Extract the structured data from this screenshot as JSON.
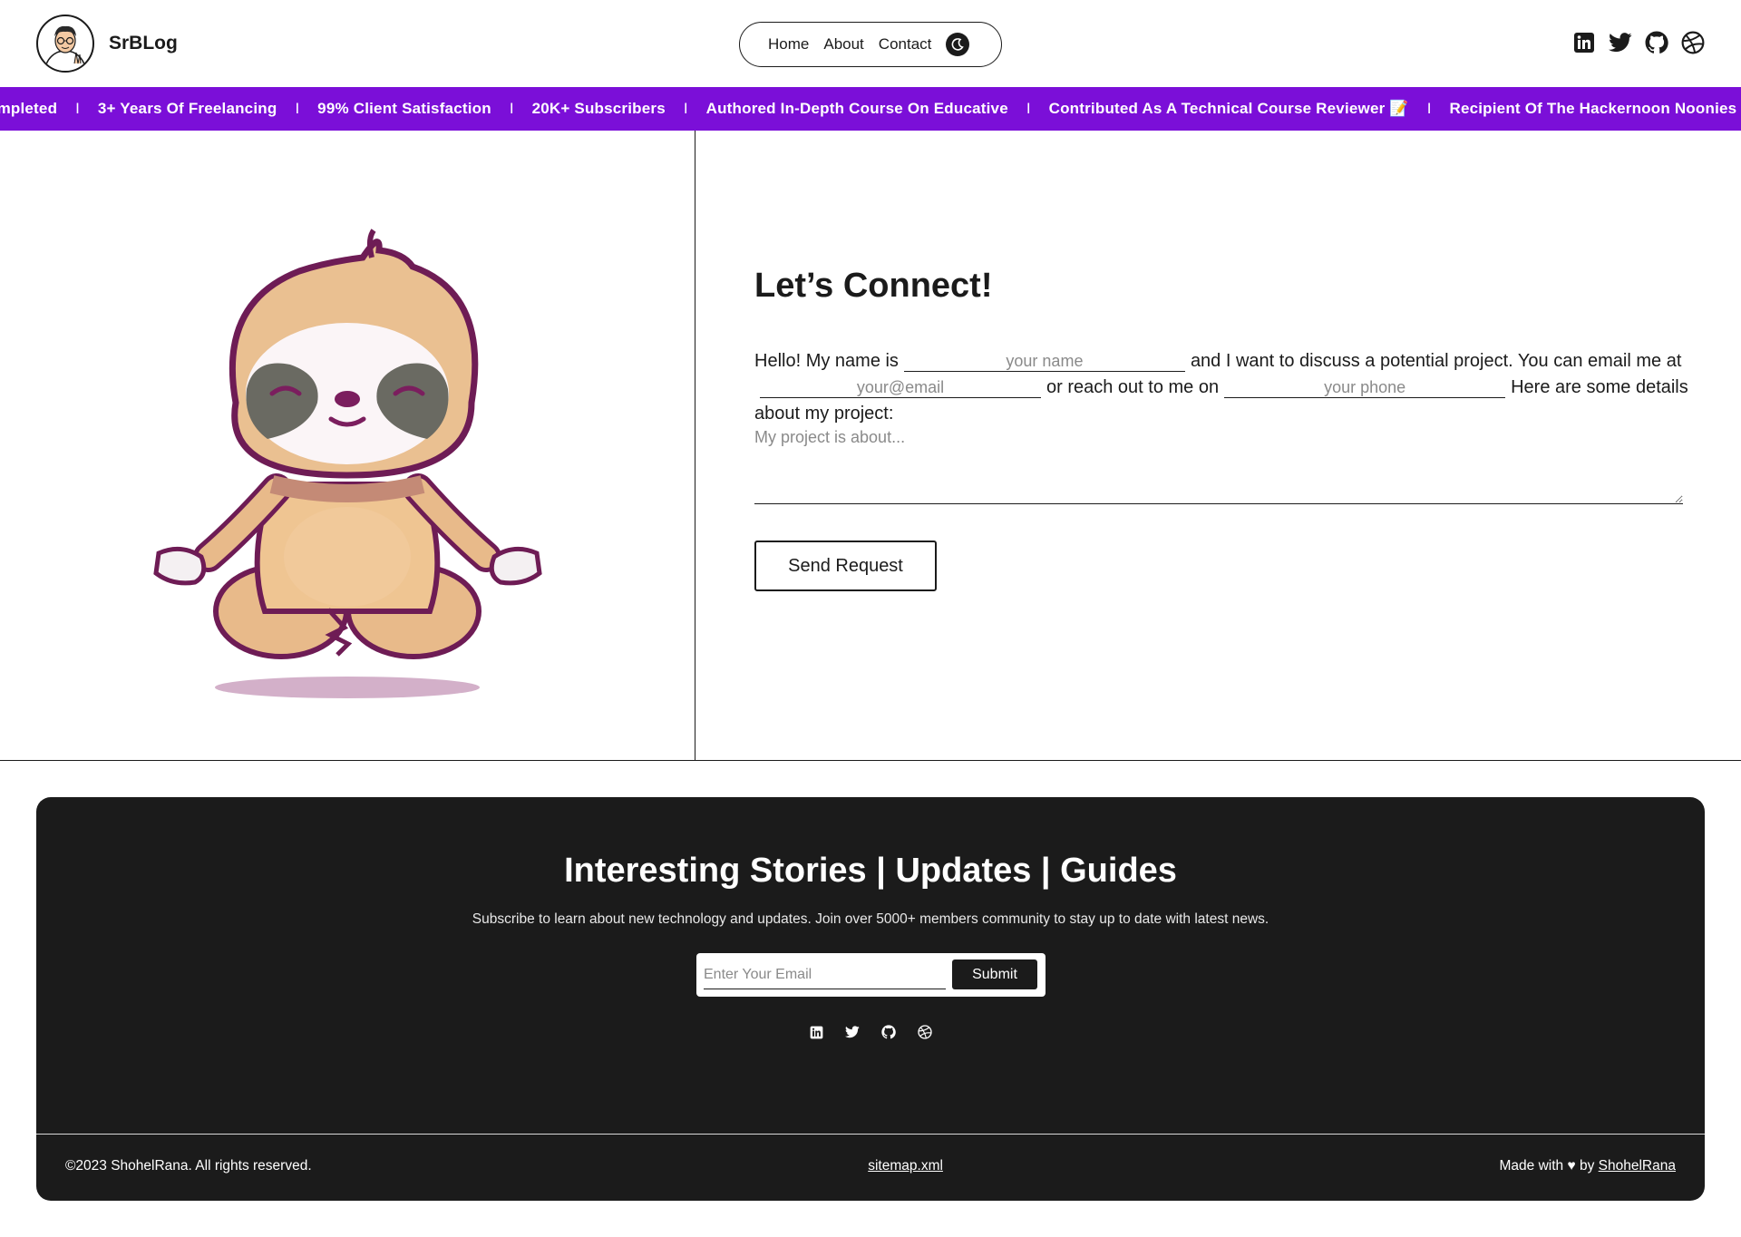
{
  "header": {
    "brand": "SrBLog",
    "nav": [
      {
        "label": "Home"
      },
      {
        "label": "About"
      },
      {
        "label": "Contact"
      }
    ],
    "theme_icon": "moon-icon",
    "socials": [
      "linkedin-icon",
      "twitter-icon",
      "github-icon",
      "dribbble-icon"
    ]
  },
  "marquee": {
    "items": [
      "ompleted",
      "3+ Years Of Freelancing",
      "99% Client Satisfaction",
      "20K+ Subscribers",
      "Authored In-Depth Course On Educative",
      "Contributed As A Technical Course Reviewer 📝",
      "Recipient Of The Hackernoon Noonies"
    ],
    "separator": "I",
    "background": "#7b0fd8"
  },
  "contact": {
    "title": "Let’s Connect!",
    "text1": "Hello! My name is",
    "name_placeholder": "your name",
    "text2": "and I want to discuss a potential project. You can email me at",
    "email_placeholder": "your@email",
    "text3": "or reach out to me on",
    "phone_placeholder": "your phone",
    "text4": "Here are some details about my project:",
    "project_placeholder": "My project is about...",
    "button": "Send Request"
  },
  "footer": {
    "title": "Interesting Stories | Updates | Guides",
    "subtitle": "Subscribe to learn about new technology and updates. Join over 5000+ members community to stay up to date with latest news.",
    "email_placeholder": "Enter Your Email",
    "submit": "Submit",
    "socials": [
      "linkedin-icon",
      "twitter-icon",
      "github-icon",
      "dribbble-icon"
    ],
    "copyright": "©2023 ShohelRana. All rights reserved.",
    "sitemap": "sitemap.xml",
    "made_with": "Made with ♥ by",
    "author": "ShohelRana"
  }
}
